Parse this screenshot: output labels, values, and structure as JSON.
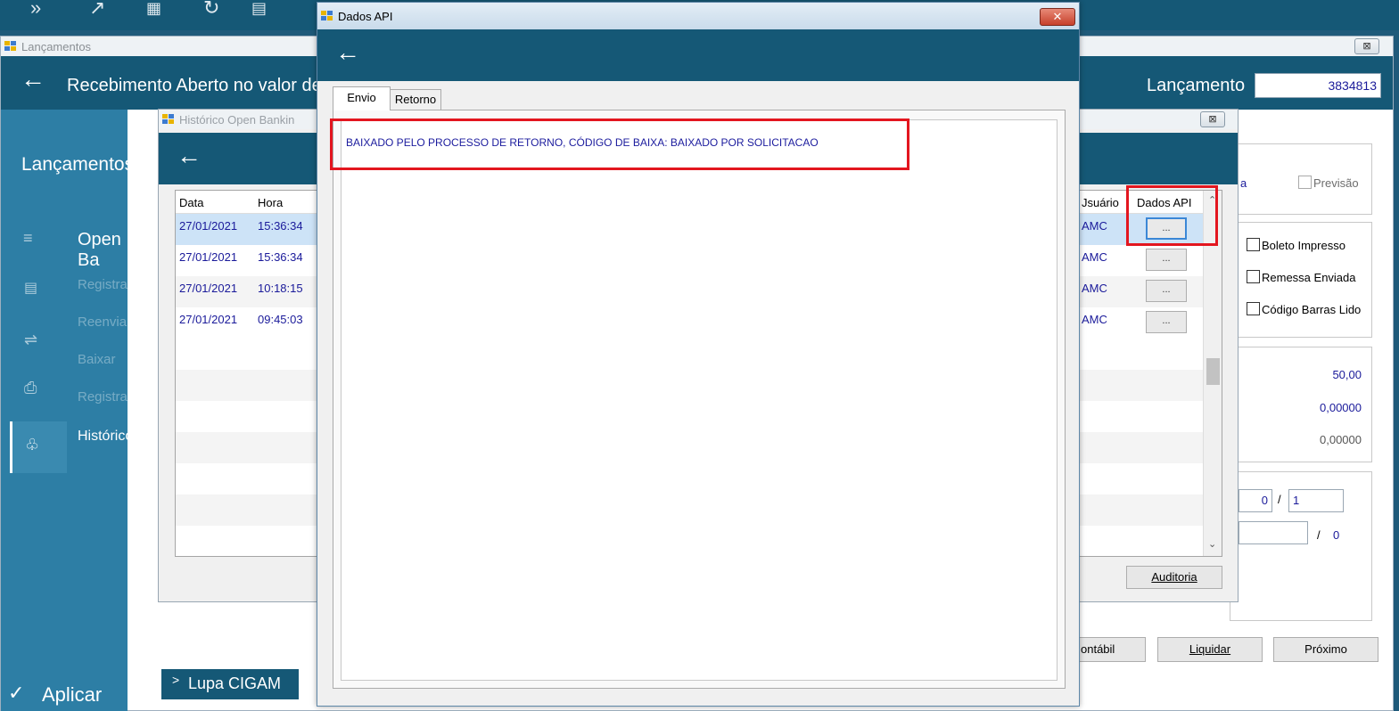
{
  "lancamentos": {
    "window_title": "Lançamentos",
    "header_title": "Recebimento Aberto no valor de",
    "lancamento_label": "Lançamento",
    "lancamento_value": "3834813",
    "sidebar": {
      "heading": "Lançamentos",
      "open_banking": "Open Ba",
      "items": [
        "Registrar",
        "Reenviar",
        "Baixar",
        "Registrar Alt",
        "Histórico"
      ]
    },
    "aplicar": "Aplicar",
    "lupa": "Lupa CIGAM",
    "previsao": "Previsão",
    "partial_a": "a",
    "checkboxes": [
      "Boleto Impresso",
      "Remessa Enviada",
      "Código Barras Lido"
    ],
    "values": [
      "50,00",
      "0,00000",
      "0,00000"
    ],
    "counter1_value": "0",
    "counter1_sep": "/",
    "counter1_total": "1",
    "counter2_sep": "/",
    "counter2_value": "0",
    "buttons": {
      "contabil": "ontábil",
      "liquidar": "Liquidar",
      "proximo": "Próximo"
    }
  },
  "historico": {
    "window_title": "Histórico Open Bankin",
    "columns": {
      "data": "Data",
      "hora": "Hora",
      "usuario": "Jsuário",
      "dados_api": "Dados API"
    },
    "rows": [
      {
        "data": "27/01/2021",
        "hora": "15:36:34",
        "usuario": "AMC"
      },
      {
        "data": "27/01/2021",
        "hora": "15:36:34",
        "usuario": "AMC"
      },
      {
        "data": "27/01/2021",
        "hora": "10:18:15",
        "usuario": "AMC"
      },
      {
        "data": "27/01/2021",
        "hora": "09:45:03",
        "usuario": "AMC"
      }
    ],
    "row_button": "...",
    "auditoria": "Auditoria"
  },
  "dados_api": {
    "window_title": "Dados API",
    "tabs": [
      "Envio",
      "Retorno"
    ],
    "message": "BAIXADO PELO PROCESSO DE RETORNO, CÓDIGO DE BAIXA: BAIXADO POR SOLICITACAO"
  },
  "icons": {
    "back": "←",
    "close": "✕",
    "minimize": "⊠",
    "check": "✓",
    "chevron": ">"
  }
}
